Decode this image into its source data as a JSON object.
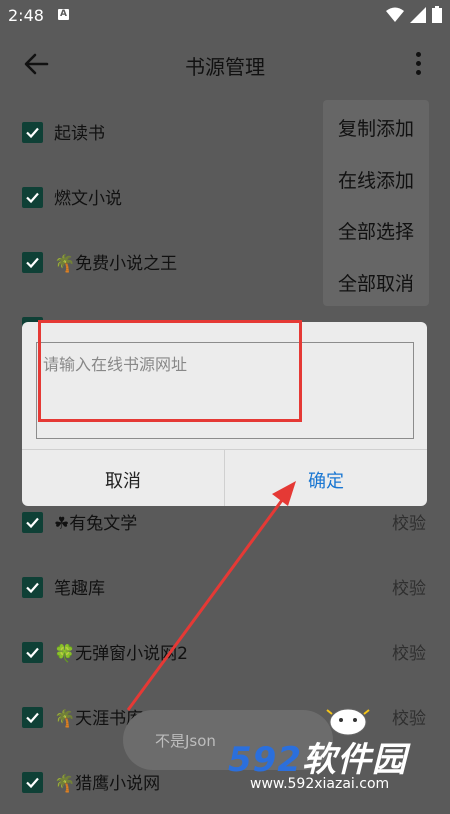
{
  "status": {
    "time": "2:48",
    "a_badge": "A"
  },
  "toolbar": {
    "title": "书源管理"
  },
  "sources": [
    {
      "name": "起读书",
      "prefix_icon": ""
    },
    {
      "name": "燃文小说",
      "prefix_icon": ""
    },
    {
      "name": "免费小说之王",
      "prefix_icon": "palm-tree-icon"
    },
    {
      "name": "",
      "prefix_icon": ""
    },
    {
      "name": "",
      "prefix_icon": ""
    },
    {
      "name": "",
      "prefix_icon": ""
    },
    {
      "name": "有兔文学",
      "prefix_icon": "shamrock-icon",
      "check": "校验"
    },
    {
      "name": "笔趣库",
      "prefix_icon": "",
      "check": "校验"
    },
    {
      "name": "无弹窗小说网2",
      "prefix_icon": "four-leaf-clover-icon",
      "check": "校验"
    },
    {
      "name": "天涯书库",
      "prefix_icon": "palm-tree-icon",
      "check": "校验"
    },
    {
      "name": "猎鹰小说网",
      "prefix_icon": "palm-tree-icon",
      "check": ""
    }
  ],
  "menu": {
    "items": [
      "复制添加",
      "在线添加",
      "全部选择",
      "全部取消"
    ]
  },
  "dialog": {
    "placeholder": "请输入在线书源网址",
    "cancel": "取消",
    "confirm": "确定"
  },
  "toast": {
    "text": "不是Json"
  },
  "watermark": {
    "logo_num": "592",
    "logo_text": "软件园",
    "url": "www.592xiazai.com"
  },
  "colors": {
    "checkbox": "#0f4036",
    "confirm": "#1976d2",
    "highlight": "#e53935"
  }
}
